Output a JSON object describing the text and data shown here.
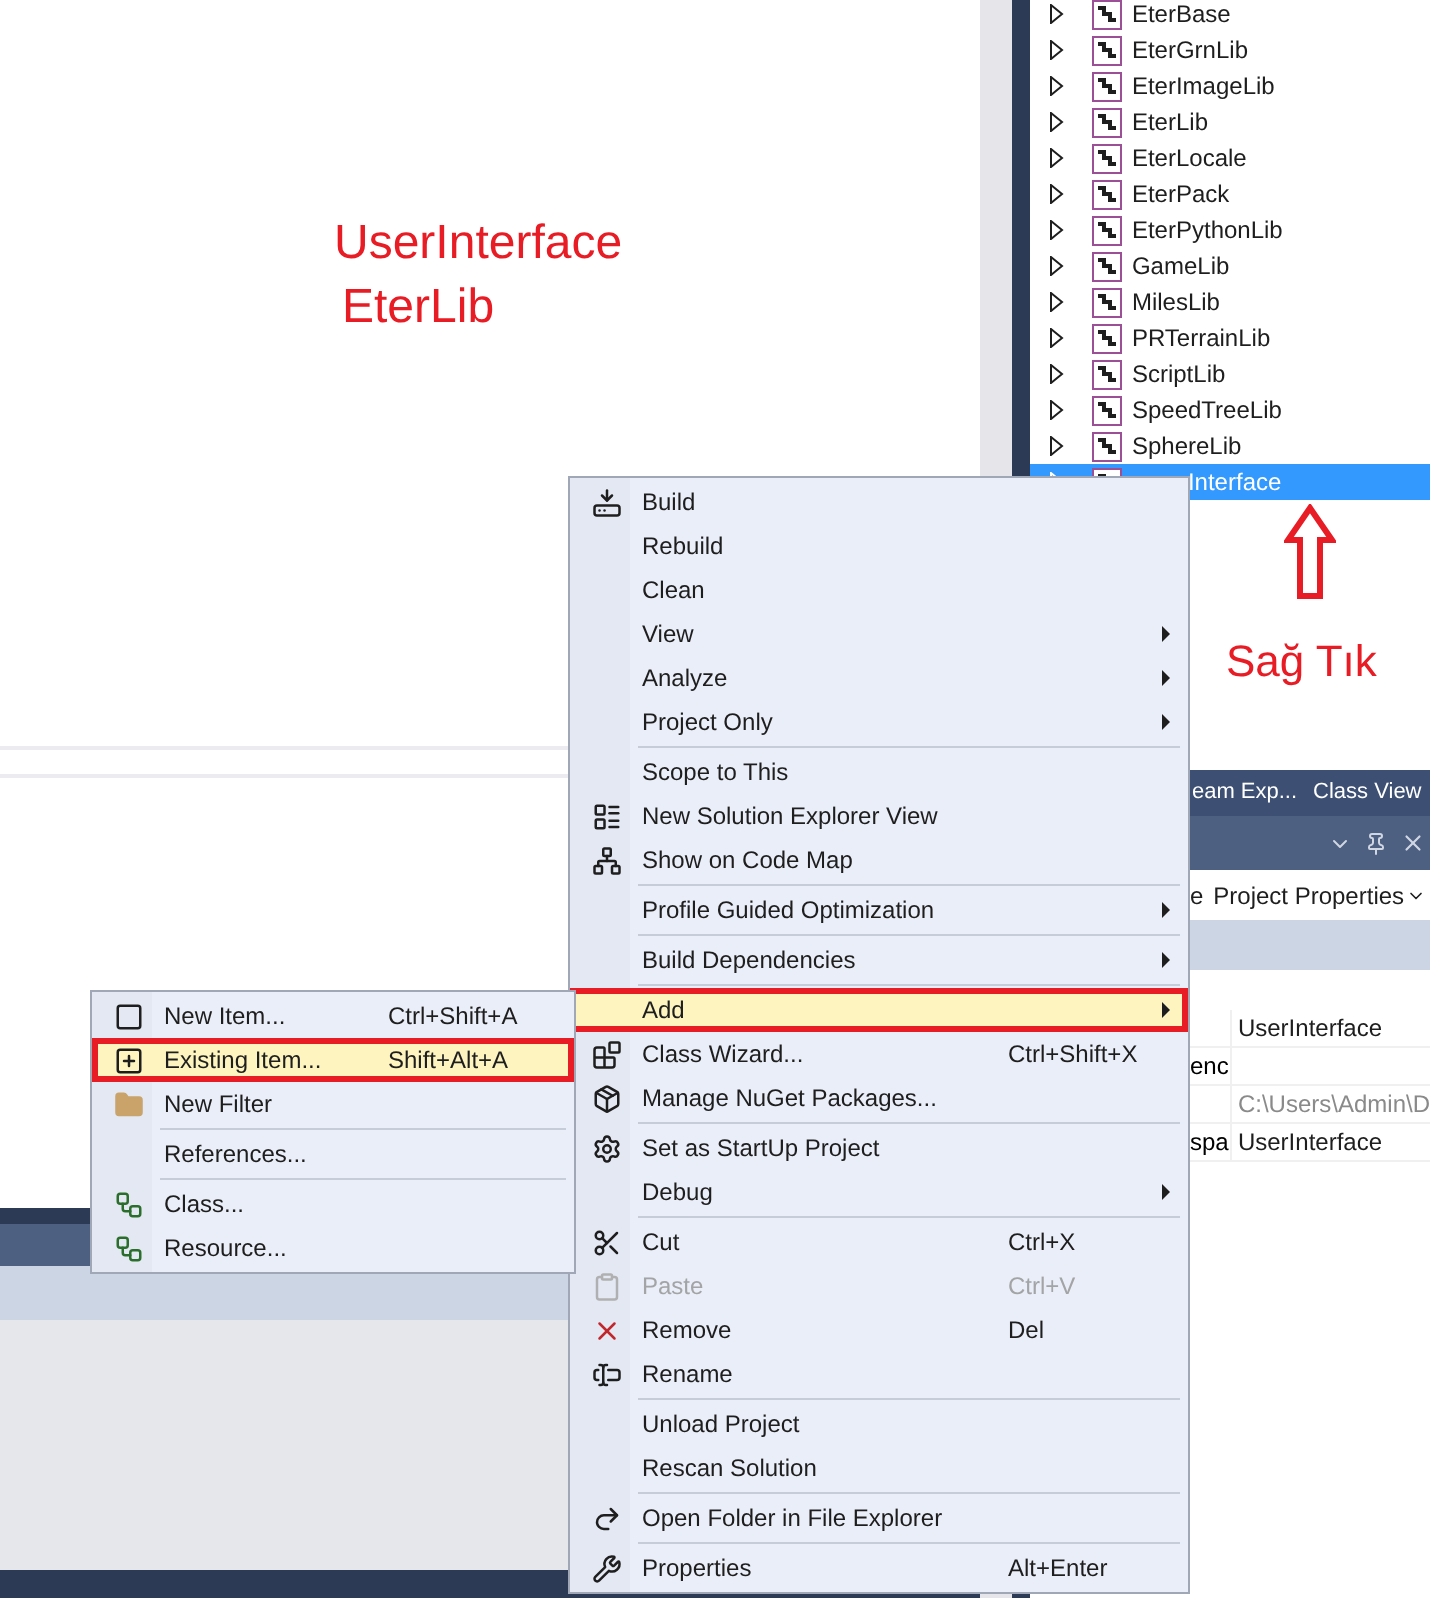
{
  "annotation": {
    "lines": [
      "UserInterface",
      "EterLib"
    ],
    "callout": "Sağ Tık"
  },
  "solution_tree": [
    {
      "label": "EterBase",
      "selected": false
    },
    {
      "label": "EterGrnLib",
      "selected": false
    },
    {
      "label": "EterImageLib",
      "selected": false
    },
    {
      "label": "EterLib",
      "selected": false
    },
    {
      "label": "EterLocale",
      "selected": false
    },
    {
      "label": "EterPack",
      "selected": false
    },
    {
      "label": "EterPythonLib",
      "selected": false
    },
    {
      "label": "GameLib",
      "selected": false
    },
    {
      "label": "MilesLib",
      "selected": false
    },
    {
      "label": "PRTerrainLib",
      "selected": false
    },
    {
      "label": "ScriptLib",
      "selected": false
    },
    {
      "label": "SpeedTreeLib",
      "selected": false
    },
    {
      "label": "SphereLib",
      "selected": false
    },
    {
      "label": "Interface",
      "selected": true
    }
  ],
  "tool_tabs": [
    {
      "label": "eam Exp...",
      "selected": false
    },
    {
      "label": "Class View",
      "selected": false
    }
  ],
  "properties": {
    "toolbar_fragment": "e",
    "toolbar_button": "Project Properties",
    "rows": [
      {
        "value": "UserInterface",
        "disabled": false
      },
      {
        "name": "enc"
      },
      {
        "value": "C:\\Users\\Admin\\D",
        "disabled": true
      },
      {
        "name": "spa",
        "value": "UserInterface",
        "disabled": false
      }
    ]
  },
  "context_menu": {
    "groups": [
      {
        "items": [
          {
            "label": "Build",
            "submenu": false,
            "disabled": false,
            "selected": false,
            "annotated": false
          },
          {
            "label": "Rebuild",
            "submenu": false,
            "disabled": false,
            "selected": false,
            "annotated": false
          },
          {
            "label": "Clean",
            "submenu": false,
            "disabled": false,
            "selected": false,
            "annotated": false
          },
          {
            "label": "View",
            "submenu": true,
            "disabled": false,
            "selected": false,
            "annotated": false
          },
          {
            "label": "Analyze",
            "submenu": true,
            "disabled": false,
            "selected": false,
            "annotated": false
          },
          {
            "label": "Project Only",
            "submenu": true,
            "disabled": false,
            "selected": false,
            "annotated": false
          }
        ]
      },
      {
        "items": [
          {
            "label": "Scope to This",
            "submenu": false,
            "disabled": false,
            "selected": false,
            "annotated": false
          },
          {
            "label": "New Solution Explorer View",
            "submenu": false,
            "disabled": false,
            "selected": false,
            "annotated": false
          },
          {
            "label": "Show on Code Map",
            "submenu": false,
            "disabled": false,
            "selected": false,
            "annotated": false
          }
        ]
      },
      {
        "items": [
          {
            "label": "Profile Guided Optimization",
            "submenu": true,
            "disabled": false,
            "selected": false,
            "annotated": false
          }
        ]
      },
      {
        "items": [
          {
            "label": "Build Dependencies",
            "submenu": true,
            "disabled": false,
            "selected": false,
            "annotated": false
          }
        ]
      },
      {
        "items": [
          {
            "label": "Add",
            "submenu": true,
            "disabled": false,
            "selected": true,
            "annotated": true
          },
          {
            "label": "Class Wizard...",
            "shortcut": "Ctrl+Shift+X",
            "submenu": false,
            "disabled": false,
            "selected": false,
            "annotated": false
          },
          {
            "label": "Manage NuGet Packages...",
            "submenu": false,
            "disabled": false,
            "selected": false,
            "annotated": false
          }
        ]
      },
      {
        "items": [
          {
            "label": "Set as StartUp Project",
            "submenu": false,
            "disabled": false,
            "selected": false,
            "annotated": false
          },
          {
            "label": "Debug",
            "submenu": true,
            "disabled": false,
            "selected": false,
            "annotated": false
          }
        ]
      },
      {
        "items": [
          {
            "label": "Cut",
            "shortcut": "Ctrl+X",
            "submenu": false,
            "disabled": false,
            "selected": false,
            "annotated": false
          },
          {
            "label": "Paste",
            "shortcut": "Ctrl+V",
            "submenu": false,
            "disabled": true,
            "selected": false,
            "annotated": false
          },
          {
            "label": "Remove",
            "shortcut": "Del",
            "submenu": false,
            "disabled": false,
            "selected": false,
            "annotated": false
          },
          {
            "label": "Rename",
            "submenu": false,
            "disabled": false,
            "selected": false,
            "annotated": false
          }
        ]
      },
      {
        "items": [
          {
            "label": "Unload Project",
            "submenu": false,
            "disabled": false,
            "selected": false,
            "annotated": false
          },
          {
            "label": "Rescan Solution",
            "submenu": false,
            "disabled": false,
            "selected": false,
            "annotated": false
          }
        ]
      },
      {
        "items": [
          {
            "label": "Open Folder in File Explorer",
            "submenu": false,
            "disabled": false,
            "selected": false,
            "annotated": false
          }
        ]
      },
      {
        "items": [
          {
            "label": "Properties",
            "shortcut": "Alt+Enter",
            "submenu": false,
            "disabled": false,
            "selected": false,
            "annotated": false
          }
        ]
      }
    ]
  },
  "add_submenu": {
    "groups": [
      {
        "items": [
          {
            "label": "New Item...",
            "shortcut": "Ctrl+Shift+A",
            "selected": false,
            "annotated": false
          },
          {
            "label": "Existing Item...",
            "shortcut": "Shift+Alt+A",
            "selected": true,
            "annotated": true
          },
          {
            "label": "New Filter",
            "selected": false,
            "annotated": false
          }
        ]
      },
      {
        "items": [
          {
            "label": "References...",
            "selected": false,
            "annotated": false
          }
        ]
      },
      {
        "items": [
          {
            "label": "Class...",
            "selected": false,
            "annotated": false
          },
          {
            "label": "Resource...",
            "selected": false,
            "annotated": false
          }
        ]
      }
    ]
  }
}
